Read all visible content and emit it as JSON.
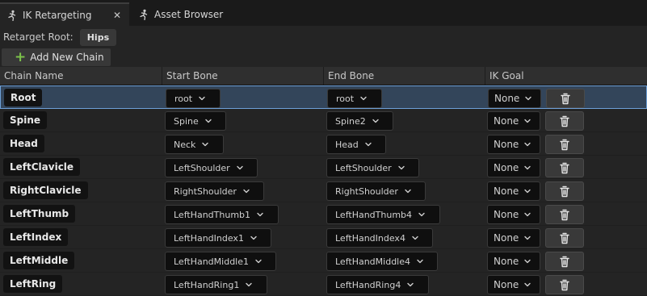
{
  "tabs": [
    {
      "label": "IK Retargeting",
      "icon": "retarget-figure-icon",
      "close": "✕"
    },
    {
      "label": "Asset Browser",
      "icon": "retarget-figure-icon"
    }
  ],
  "retarget_root": {
    "label": "Retarget Root:",
    "value": "Hips"
  },
  "add_chain": {
    "label": "Add New Chain",
    "icon": "plus-icon"
  },
  "columns": [
    "Chain Name",
    "Start Bone",
    "End Bone",
    "IK Goal"
  ],
  "rows": [
    {
      "name": "Root",
      "start": "root",
      "end": "root",
      "goal": "None",
      "selected": true
    },
    {
      "name": "Spine",
      "start": "Spine",
      "end": "Spine2",
      "goal": "None"
    },
    {
      "name": "Head",
      "start": "Neck",
      "end": "Head",
      "goal": "None"
    },
    {
      "name": "LeftClavicle",
      "start": "LeftShoulder",
      "end": "LeftShoulder",
      "goal": "None"
    },
    {
      "name": "RightClavicle",
      "start": "RightShoulder",
      "end": "RightShoulder",
      "goal": "None"
    },
    {
      "name": "LeftThumb",
      "start": "LeftHandThumb1",
      "end": "LeftHandThumb4",
      "goal": "None"
    },
    {
      "name": "LeftIndex",
      "start": "LeftHandIndex1",
      "end": "LeftHandIndex4",
      "goal": "None"
    },
    {
      "name": "LeftMiddle",
      "start": "LeftHandMiddle1",
      "end": "LeftHandMiddle4",
      "goal": "None"
    },
    {
      "name": "LeftRing",
      "start": "LeftHandRing1",
      "end": "LeftHandRing4",
      "goal": "None"
    }
  ],
  "colors": {
    "selected_row": "#33455a",
    "selected_border": "#6ea0d8",
    "add_icon": "#7cc24a"
  }
}
